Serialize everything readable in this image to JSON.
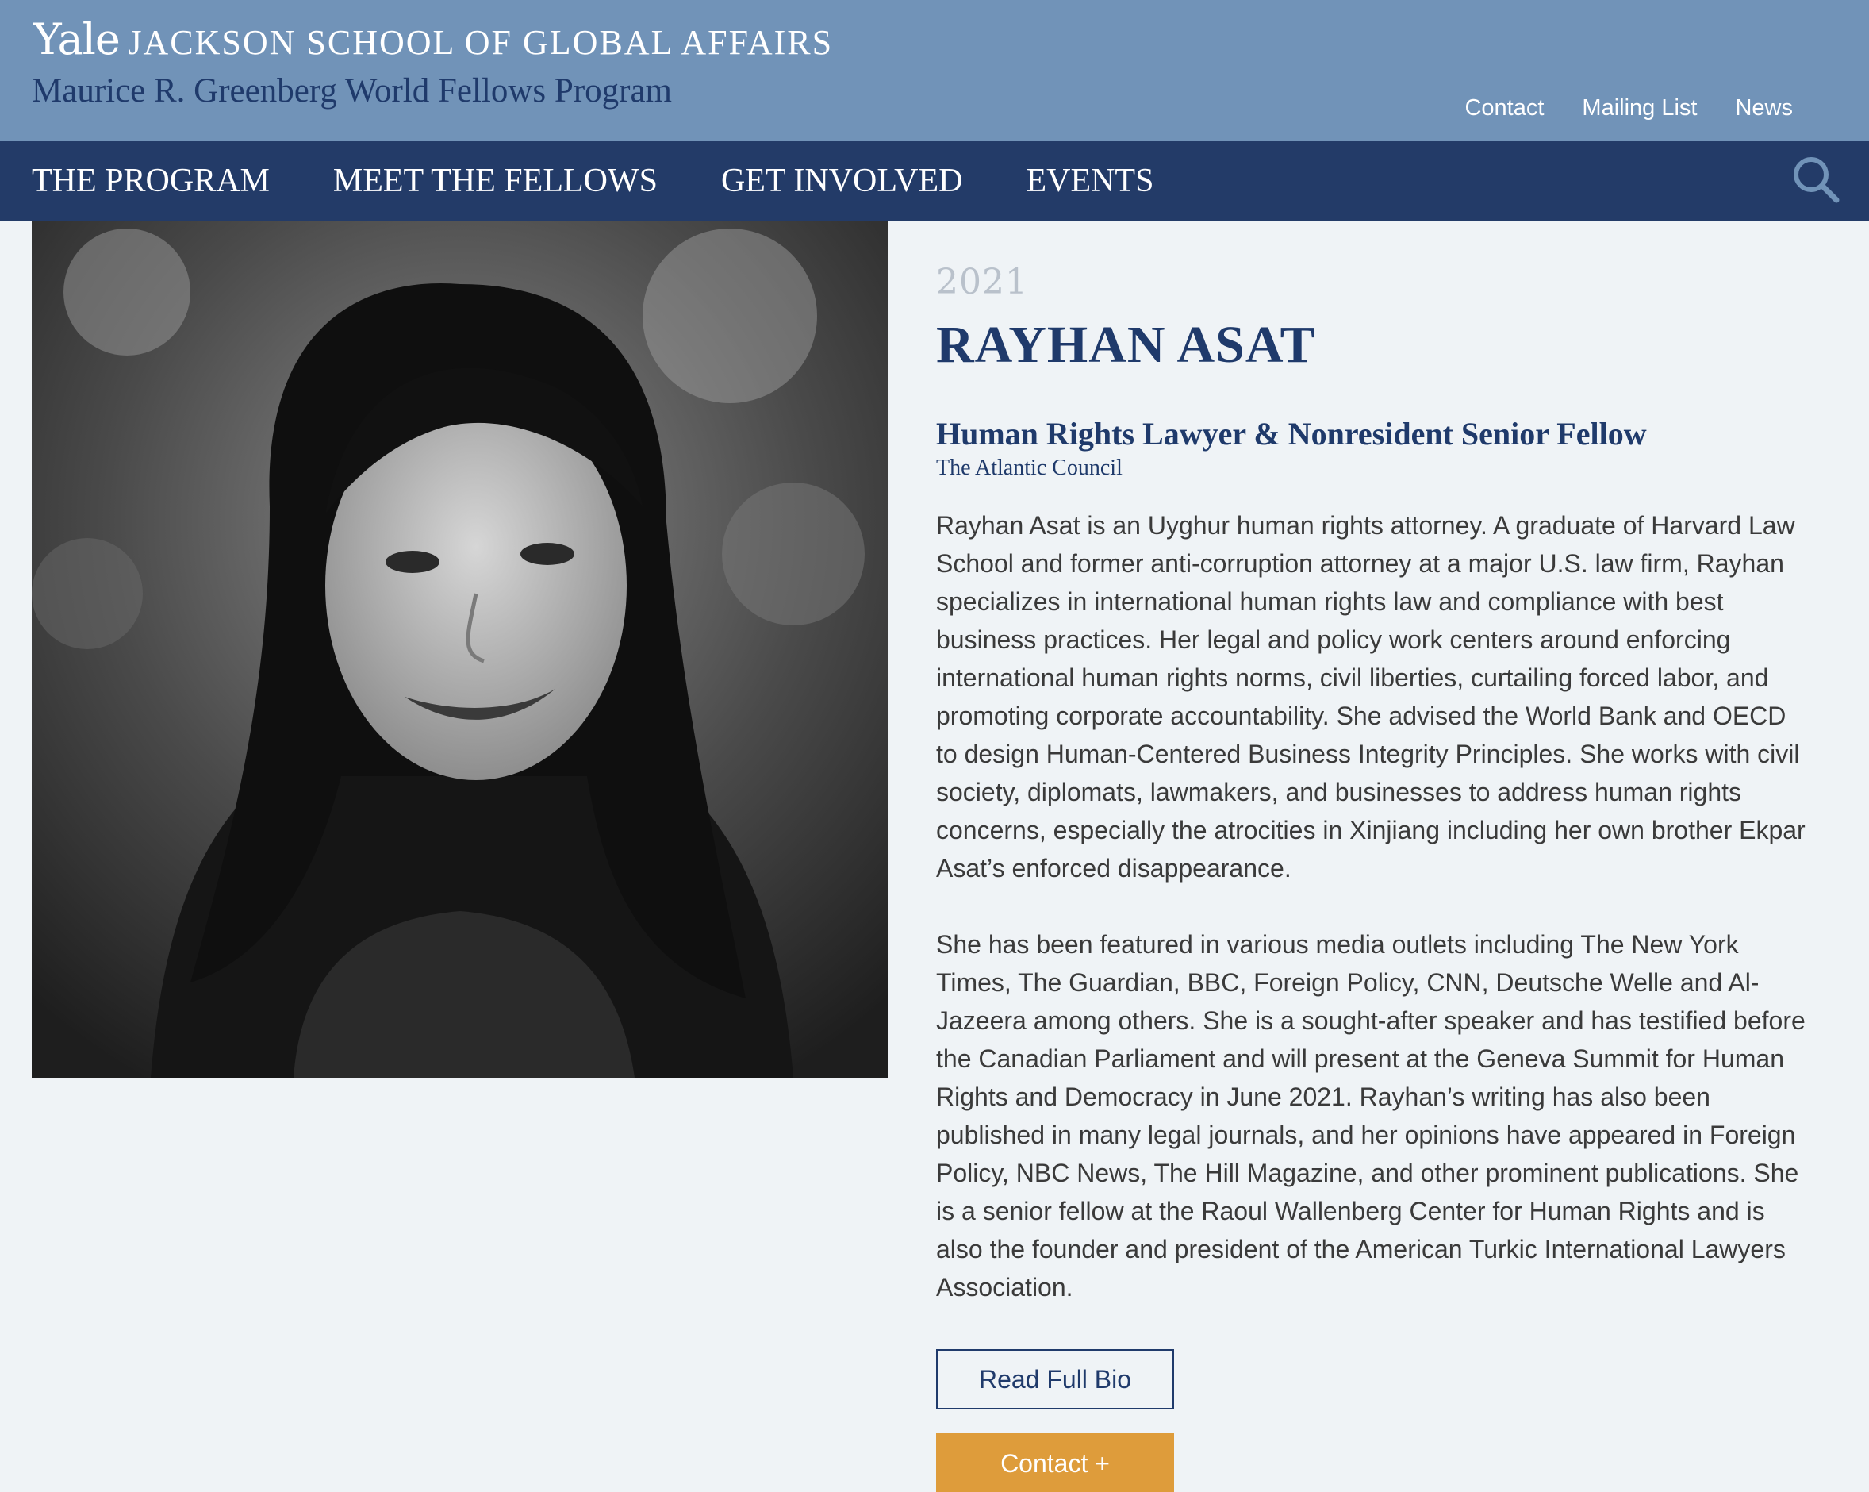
{
  "header": {
    "brand_yale": "Yale",
    "brand_school": "JACKSON SCHOOL OF GLOBAL AFFAIRS",
    "program_name": "Maurice R. Greenberg World Fellows Program",
    "utility_links": [
      "Contact",
      "Mailing List",
      "News"
    ]
  },
  "nav": {
    "items": [
      "THE PROGRAM",
      "MEET THE FELLOWS",
      "GET INVOLVED",
      "EVENTS"
    ],
    "search_icon": "search-icon"
  },
  "profile": {
    "year": "2021",
    "name": "RAYHAN ASAT",
    "title": "Human Rights Lawyer & Nonresident Senior Fellow",
    "organization": "The Atlantic Council",
    "bio_paragraph_1": "Rayhan Asat is an Uyghur human rights attorney. A graduate of Harvard Law School and former anti-corruption attorney at a major U.S. law firm, Rayhan specializes in international human rights law and compliance with best business practices. Her legal and policy work centers around enforcing international human rights norms, civil liberties, curtailing forced labor, and promoting corporate accountability. She advised the World Bank and OECD to design Human-Centered Business Integrity Principles. She works with civil society, diplomats, lawmakers, and businesses to address human rights concerns, especially the atrocities in Xinjiang including her own brother Ekpar Asat’s enforced disappearance.",
    "bio_paragraph_2": "She has been featured in various media outlets including The New York Times, The Guardian, BBC, Foreign Policy, CNN, Deutsche Welle and Al-Jazeera among others. She is a sought-after speaker and has testified before the Canadian Parliament and will present at the Geneva Summit for Human Rights and Democracy in June 2021. Rayhan’s writing has also been published in many legal journals, and her opinions have appeared in Foreign Policy, NBC News, The Hill Magazine, and other prominent publications. She is a senior fellow at the Raoul Wallenberg Center for Human Rights and is also the founder and president of the American Turkic International Lawyers Association.",
    "read_bio_label": "Read Full Bio",
    "contact_label": "Contact +"
  },
  "colors": {
    "top_bar": "#7193b8",
    "nav_bar": "#233b68",
    "accent_navy": "#1f3a6b",
    "contact_button": "#de9c3b",
    "page_background": "#eff3f6"
  }
}
